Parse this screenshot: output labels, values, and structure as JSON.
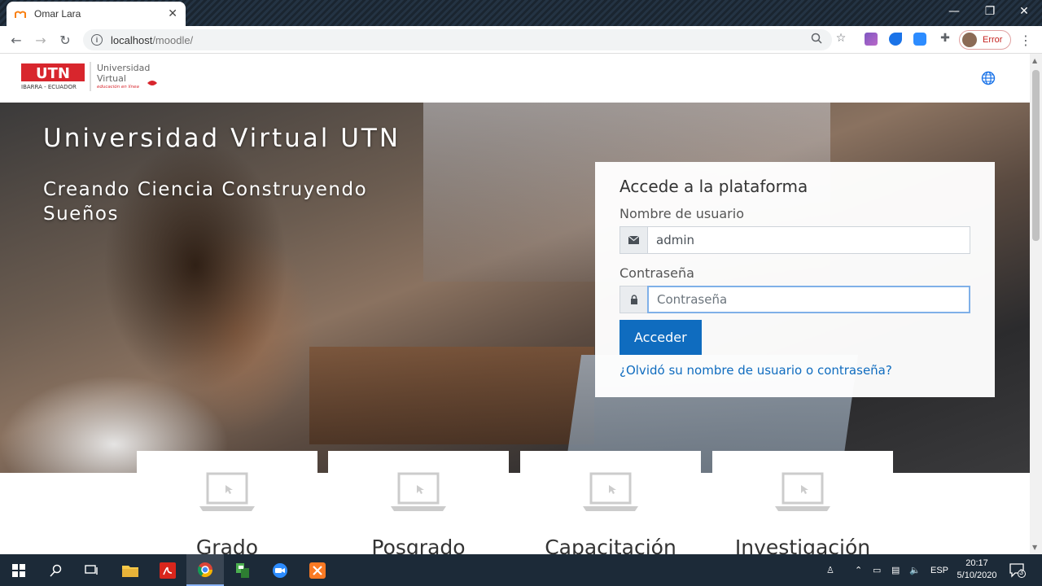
{
  "browser": {
    "tab_title": "Omar Lara",
    "url_host": "localhost",
    "url_path": "/moodle/",
    "profile_label": "Error"
  },
  "site": {
    "logo_text_1": "Universidad",
    "logo_text_2": "Virtual",
    "logo_tagline": "educación en línea",
    "logo_abbr": "UTN",
    "logo_place": "IBARRA - ECUADOR"
  },
  "hero": {
    "title": "Universidad Virtual UTN",
    "subtitle": "Creando Ciencia Construyendo Sueños"
  },
  "login": {
    "heading": "Accede a la plataforma",
    "username_label": "Nombre de usuario",
    "username_value": "admin",
    "password_label": "Contraseña",
    "password_placeholder": "Contraseña",
    "submit_label": "Acceder",
    "forgot_link": "¿Olvidó su nombre de usuario o contraseña?"
  },
  "cards": [
    {
      "label": "Grado"
    },
    {
      "label": "Posgrado"
    },
    {
      "label": "Capacitación"
    },
    {
      "label": "Investigación"
    }
  ],
  "taskbar": {
    "language": "ESP",
    "time": "20:17",
    "date": "5/10/2020",
    "notifications": "3"
  },
  "colors": {
    "brand_red": "#d8262d",
    "primary_blue": "#0f6cbf"
  }
}
